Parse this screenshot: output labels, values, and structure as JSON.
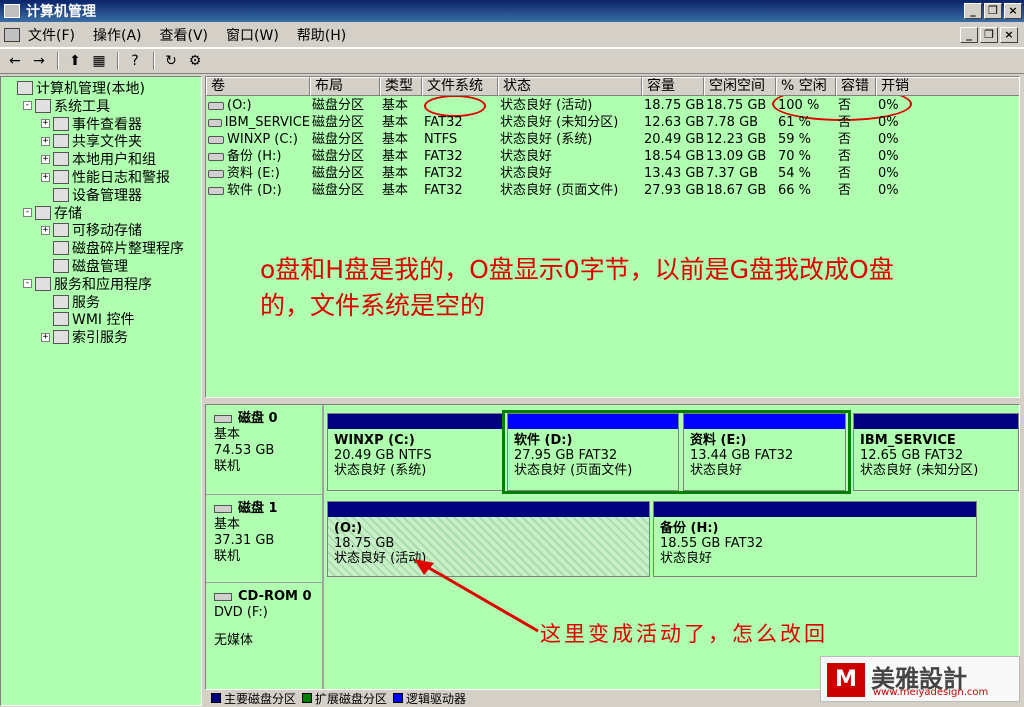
{
  "window": {
    "title": "计算机管理",
    "minimize": "_",
    "restore": "❐",
    "close": "×"
  },
  "menu": [
    "文件(F)",
    "操作(A)",
    "查看(V)",
    "窗口(W)",
    "帮助(H)"
  ],
  "toolbar": [
    "←",
    "→",
    "⬆",
    "▦",
    "?",
    "↻",
    "⚙"
  ],
  "tree": [
    {
      "label": "计算机管理(本地)",
      "level": 0,
      "expander": ""
    },
    {
      "label": "系统工具",
      "level": 1,
      "expander": "-"
    },
    {
      "label": "事件查看器",
      "level": 2,
      "expander": "+"
    },
    {
      "label": "共享文件夹",
      "level": 2,
      "expander": "+"
    },
    {
      "label": "本地用户和组",
      "level": 2,
      "expander": "+"
    },
    {
      "label": "性能日志和警报",
      "level": 2,
      "expander": "+"
    },
    {
      "label": "设备管理器",
      "level": 2,
      "expander": ""
    },
    {
      "label": "存储",
      "level": 1,
      "expander": "-"
    },
    {
      "label": "可移动存储",
      "level": 2,
      "expander": "+"
    },
    {
      "label": "磁盘碎片整理程序",
      "level": 2,
      "expander": ""
    },
    {
      "label": "磁盘管理",
      "level": 2,
      "expander": ""
    },
    {
      "label": "服务和应用程序",
      "level": 1,
      "expander": "-"
    },
    {
      "label": "服务",
      "level": 2,
      "expander": ""
    },
    {
      "label": "WMI 控件",
      "level": 2,
      "expander": ""
    },
    {
      "label": "索引服务",
      "level": 2,
      "expander": "+"
    }
  ],
  "columns": [
    "卷",
    "布局",
    "类型",
    "文件系统",
    "状态",
    "容量",
    "空闲空间",
    "% 空闲",
    "容错",
    "开销"
  ],
  "volumes": [
    [
      "(O:)",
      "磁盘分区",
      "基本",
      "",
      "状态良好 (活动)",
      "18.75 GB",
      "18.75 GB",
      "100 %",
      "否",
      "0%"
    ],
    [
      "IBM_SERVICE",
      "磁盘分区",
      "基本",
      "FAT32",
      "状态良好 (未知分区)",
      "12.63 GB",
      "7.78 GB",
      "61 %",
      "否",
      "0%"
    ],
    [
      "WINXP (C:)",
      "磁盘分区",
      "基本",
      "NTFS",
      "状态良好 (系统)",
      "20.49 GB",
      "12.23 GB",
      "59 %",
      "否",
      "0%"
    ],
    [
      "备份 (H:)",
      "磁盘分区",
      "基本",
      "FAT32",
      "状态良好",
      "18.54 GB",
      "13.09 GB",
      "70 %",
      "否",
      "0%"
    ],
    [
      "资料 (E:)",
      "磁盘分区",
      "基本",
      "FAT32",
      "状态良好",
      "13.43 GB",
      "7.37 GB",
      "54 %",
      "否",
      "0%"
    ],
    [
      "软件 (D:)",
      "磁盘分区",
      "基本",
      "FAT32",
      "状态良好 (页面文件)",
      "27.93 GB",
      "18.67 GB",
      "66 %",
      "否",
      "0%"
    ]
  ],
  "annotation": "o盘和H盘是我的，O盘显示0字节，以前是G盘我改成O盘的，文件系统是空的",
  "disks": [
    {
      "name": "磁盘 0",
      "type": "基本",
      "size": "74.53 GB",
      "state": "联机",
      "partitions": [
        {
          "name": "WINXP  (C:)",
          "detail": "20.49 GB NTFS",
          "status": "状态良好 (系统)",
          "kind": "primary"
        },
        {
          "name": "软件  (D:)",
          "detail": "27.95 GB FAT32",
          "status": "状态良好 (页面文件)",
          "kind": "logical"
        },
        {
          "name": "资料  (E:)",
          "detail": "13.44 GB FAT32",
          "status": "状态良好",
          "kind": "logical"
        },
        {
          "name": "IBM_SERVICE",
          "detail": "12.65 GB FAT32",
          "status": "状态良好 (未知分区)",
          "kind": "primary"
        }
      ]
    },
    {
      "name": "磁盘 1",
      "type": "基本",
      "size": "37.31 GB",
      "state": "联机",
      "partitions": [
        {
          "name": "(O:)",
          "detail": "18.75 GB",
          "status": "状态良好 (活动)",
          "kind": "primary"
        },
        {
          "name": "备份  (H:)",
          "detail": "18.55 GB FAT32",
          "status": "状态良好",
          "kind": "primary"
        }
      ]
    },
    {
      "name": "CD-ROM 0",
      "type": "DVD (F:)",
      "size": "",
      "state": "无媒体",
      "partitions": []
    }
  ],
  "arrow_note": "这里变成活动了，怎么改回",
  "legend": [
    {
      "label": "主要磁盘分区",
      "color": "#000080"
    },
    {
      "label": "扩展磁盘分区",
      "color": "#008000"
    },
    {
      "label": "逻辑驱动器",
      "color": "#0000ff"
    }
  ],
  "watermark": {
    "brand": "美雅設計",
    "url": "www.meiyadesign.com"
  }
}
